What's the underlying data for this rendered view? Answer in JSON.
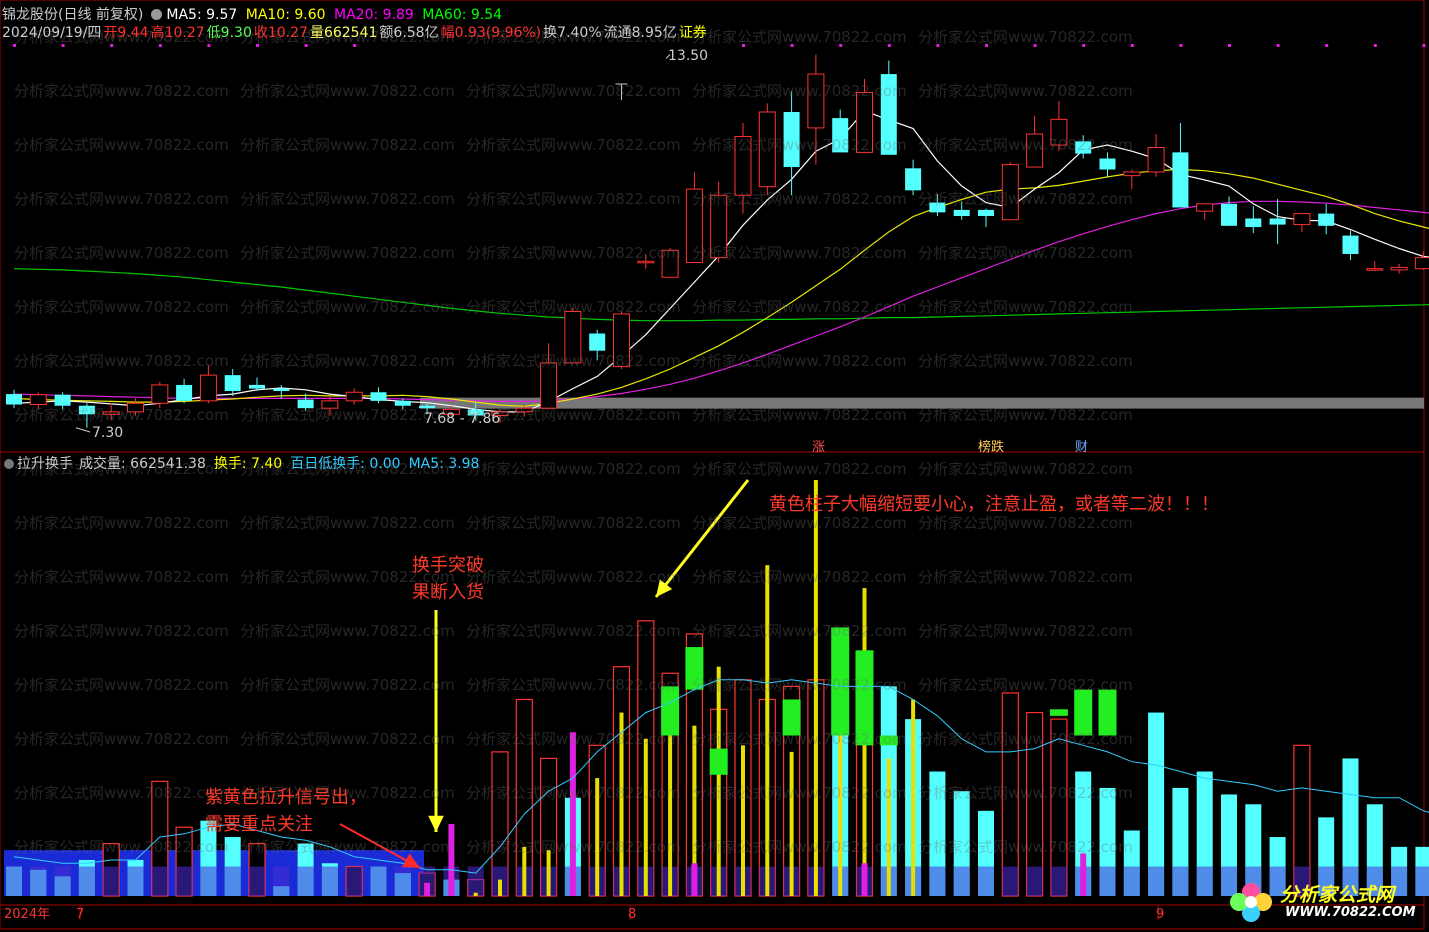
{
  "header": {
    "title": "锦龙股份(日线 前复权)",
    "ma5_label": "MA5: 9.57",
    "ma10_label": "MA10: 9.60",
    "ma20_label": "MA20: 9.89",
    "ma60_label": "MA60: 9.54",
    "date": "2024/09/19/四",
    "open": "开9.44",
    "high": "高10.27",
    "low": "低9.30",
    "close": "收10.27",
    "volume": "量662541",
    "amount": "额6.58亿",
    "change": "幅0.93(9.96%)",
    "turnover": "换7.40%",
    "float_cap": "流通8.95亿",
    "sector": "证券",
    "colors": {
      "ma5": "#ffffff",
      "ma10": "#ffff00",
      "ma20": "#ff00ff",
      "ma60": "#00ff00",
      "up": "#ff3232",
      "down": "#54ffff"
    }
  },
  "price_labels": {
    "high_label": "13.50",
    "low_label": "7.30",
    "band_label": "7.68 - 7.86"
  },
  "event_tags": {
    "t1": "涨",
    "t2": "榜跌",
    "t3": "财"
  },
  "indicator": {
    "name": "拉升换手",
    "vol_label": "成交量: 662541.38",
    "turn_label": "换手: 7.40",
    "low_turn_label": "百日低换手: 0.00",
    "ma5_label": "MA5: 3.98"
  },
  "annotations": {
    "a1_l1": "换手突破",
    "a1_l2": "果断入货",
    "a2": "黄色柱子大幅缩短要小心，注意止盈，或者等二波！！！",
    "a3_l1": "紫黄色拉升信号出，",
    "a3_l2": "需要重点关注"
  },
  "time_axis": {
    "year": "2024年",
    "m7": "7",
    "m8": "8",
    "m9": "9"
  },
  "watermark": "分析家公式网www.70822.com",
  "logo": {
    "name": "分析家公式网",
    "url": "WWW.70822.COM"
  },
  "chart_data": {
    "type": "candlestick",
    "candles": [
      {
        "o": 7.95,
        "h": 8.02,
        "l": 7.72,
        "c": 7.78
      },
      {
        "o": 7.78,
        "h": 7.98,
        "l": 7.7,
        "c": 7.94
      },
      {
        "o": 7.94,
        "h": 7.98,
        "l": 7.7,
        "c": 7.76
      },
      {
        "o": 7.76,
        "h": 7.8,
        "l": 7.4,
        "c": 7.62
      },
      {
        "o": 7.62,
        "h": 7.8,
        "l": 7.52,
        "c": 7.66
      },
      {
        "o": 7.66,
        "h": 7.88,
        "l": 7.6,
        "c": 7.8
      },
      {
        "o": 7.8,
        "h": 8.15,
        "l": 7.72,
        "c": 8.1
      },
      {
        "o": 8.1,
        "h": 8.2,
        "l": 7.8,
        "c": 7.84
      },
      {
        "o": 7.84,
        "h": 8.42,
        "l": 7.8,
        "c": 8.26
      },
      {
        "o": 8.26,
        "h": 8.36,
        "l": 7.92,
        "c": 8.0
      },
      {
        "o": 8.1,
        "h": 8.22,
        "l": 8.0,
        "c": 8.04
      },
      {
        "o": 8.04,
        "h": 8.1,
        "l": 7.88,
        "c": 8.0
      },
      {
        "o": 7.86,
        "h": 7.96,
        "l": 7.68,
        "c": 7.72
      },
      {
        "o": 7.72,
        "h": 7.92,
        "l": 7.6,
        "c": 7.84
      },
      {
        "o": 7.84,
        "h": 8.04,
        "l": 7.78,
        "c": 7.98
      },
      {
        "o": 7.98,
        "h": 8.06,
        "l": 7.8,
        "c": 7.84
      },
      {
        "o": 7.84,
        "h": 7.88,
        "l": 7.7,
        "c": 7.76
      },
      {
        "o": 7.76,
        "h": 7.82,
        "l": 7.62,
        "c": 7.72
      },
      {
        "o": 7.62,
        "h": 7.76,
        "l": 7.56,
        "c": 7.7
      },
      {
        "o": 7.7,
        "h": 7.82,
        "l": 7.52,
        "c": 7.6
      },
      {
        "o": 7.6,
        "h": 7.7,
        "l": 7.48,
        "c": 7.66
      },
      {
        "o": 7.66,
        "h": 7.76,
        "l": 7.58,
        "c": 7.72
      },
      {
        "o": 7.72,
        "h": 8.78,
        "l": 7.72,
        "c": 8.46
      },
      {
        "o": 8.46,
        "h": 9.36,
        "l": 8.46,
        "c": 9.3
      },
      {
        "o": 8.94,
        "h": 9.0,
        "l": 8.5,
        "c": 8.66
      },
      {
        "o": 8.4,
        "h": 9.3,
        "l": 8.36,
        "c": 9.26
      },
      {
        "o": 10.12,
        "h": 10.24,
        "l": 10.0,
        "c": 10.12
      },
      {
        "o": 9.86,
        "h": 10.34,
        "l": 9.86,
        "c": 10.3
      },
      {
        "o": 10.1,
        "h": 11.58,
        "l": 10.1,
        "c": 11.3
      },
      {
        "o": 10.18,
        "h": 11.42,
        "l": 10.1,
        "c": 11.2
      },
      {
        "o": 11.2,
        "h": 12.38,
        "l": 10.9,
        "c": 12.16
      },
      {
        "o": 11.34,
        "h": 12.7,
        "l": 11.2,
        "c": 12.56
      },
      {
        "o": 12.56,
        "h": 12.9,
        "l": 11.2,
        "c": 11.66
      },
      {
        "o": 12.3,
        "h": 13.5,
        "l": 11.7,
        "c": 13.18
      },
      {
        "o": 12.46,
        "h": 12.6,
        "l": 11.9,
        "c": 11.9
      },
      {
        "o": 11.9,
        "h": 13.1,
        "l": 11.9,
        "c": 12.88
      },
      {
        "o": 13.18,
        "h": 13.4,
        "l": 11.86,
        "c": 11.86
      },
      {
        "o": 11.64,
        "h": 11.78,
        "l": 11.2,
        "c": 11.28
      },
      {
        "o": 11.08,
        "h": 11.22,
        "l": 10.86,
        "c": 10.92
      },
      {
        "o": 10.96,
        "h": 11.1,
        "l": 10.8,
        "c": 10.86
      },
      {
        "o": 10.96,
        "h": 10.98,
        "l": 10.68,
        "c": 10.86
      },
      {
        "o": 10.8,
        "h": 11.74,
        "l": 10.8,
        "c": 11.7
      },
      {
        "o": 11.66,
        "h": 12.5,
        "l": 11.66,
        "c": 12.2
      },
      {
        "o": 12.02,
        "h": 12.74,
        "l": 11.92,
        "c": 12.44
      },
      {
        "o": 12.08,
        "h": 12.18,
        "l": 11.8,
        "c": 11.88
      },
      {
        "o": 11.8,
        "h": 11.9,
        "l": 11.5,
        "c": 11.62
      },
      {
        "o": 11.52,
        "h": 11.62,
        "l": 11.3,
        "c": 11.58
      },
      {
        "o": 11.58,
        "h": 12.2,
        "l": 11.5,
        "c": 11.98
      },
      {
        "o": 11.9,
        "h": 12.38,
        "l": 11.0,
        "c": 11.0
      },
      {
        "o": 10.94,
        "h": 11.06,
        "l": 10.8,
        "c": 11.06
      },
      {
        "o": 11.06,
        "h": 11.18,
        "l": 10.7,
        "c": 10.7
      },
      {
        "o": 10.82,
        "h": 11.02,
        "l": 10.58,
        "c": 10.68
      },
      {
        "o": 10.82,
        "h": 11.14,
        "l": 10.4,
        "c": 10.72
      },
      {
        "o": 10.72,
        "h": 10.9,
        "l": 10.6,
        "c": 10.9
      },
      {
        "o": 10.9,
        "h": 11.06,
        "l": 10.56,
        "c": 10.7
      },
      {
        "o": 10.54,
        "h": 10.62,
        "l": 10.14,
        "c": 10.24
      },
      {
        "o": 10.0,
        "h": 10.12,
        "l": 9.96,
        "c": 10.0
      },
      {
        "o": 9.98,
        "h": 10.08,
        "l": 9.92,
        "c": 10.02
      },
      {
        "o": 10.0,
        "h": 10.28,
        "l": 9.98,
        "c": 10.18
      },
      {
        "o": 10.62,
        "h": 11.0,
        "l": 10.6,
        "c": 10.62
      },
      {
        "o": 10.14,
        "h": 10.42,
        "l": 10.0,
        "c": 10.36
      },
      {
        "o": 10.34,
        "h": 10.4,
        "l": 10.22,
        "c": 10.3
      },
      {
        "o": 10.2,
        "h": 10.24,
        "l": 10.06,
        "c": 10.16
      },
      {
        "o": 10.16,
        "h": 10.26,
        "l": 10.08,
        "c": 10.2
      },
      {
        "o": 10.16,
        "h": 10.22,
        "l": 10.02,
        "c": 10.04
      },
      {
        "o": 10.04,
        "h": 10.18,
        "l": 9.96,
        "c": 10.14
      },
      {
        "o": 9.94,
        "h": 10.14,
        "l": 9.88,
        "c": 10.04
      },
      {
        "o": 9.44,
        "h": 10.27,
        "l": 9.3,
        "c": 10.27
      }
    ],
    "ma5": [
      7.8,
      7.82,
      7.84,
      7.82,
      7.79,
      7.76,
      7.8,
      7.86,
      7.92,
      7.95,
      8.02,
      8.05,
      8.02,
      7.95,
      7.91,
      7.86,
      7.83,
      7.81,
      7.76,
      7.7,
      7.66,
      7.66,
      7.83,
      8.04,
      8.24,
      8.57,
      8.92,
      9.35,
      9.78,
      10.21,
      10.71,
      11.12,
      11.46,
      11.92,
      12.12,
      12.58,
      12.43,
      12.29,
      11.76,
      11.35,
      11.08,
      11.0,
      11.3,
      11.57,
      11.94,
      12.02,
      11.92,
      11.8,
      11.54,
      11.45,
      11.35,
      11.06,
      10.85,
      10.79,
      10.78,
      10.64,
      10.48,
      10.33,
      10.2,
      10.15,
      10.18,
      10.28,
      10.34,
      10.32,
      10.24,
      10.18,
      10.15,
      10.06,
      10.09
    ],
    "ma10": [
      7.88,
      7.86,
      7.85,
      7.84,
      7.83,
      7.82,
      7.82,
      7.83,
      7.85,
      7.87,
      7.9,
      7.92,
      7.93,
      7.92,
      7.92,
      7.92,
      7.93,
      7.91,
      7.87,
      7.82,
      7.77,
      7.75,
      7.8,
      7.87,
      7.95,
      8.06,
      8.2,
      8.36,
      8.55,
      8.74,
      8.96,
      9.2,
      9.45,
      9.72,
      9.99,
      10.3,
      10.6,
      10.85,
      11.0,
      11.13,
      11.25,
      11.3,
      11.32,
      11.36,
      11.43,
      11.5,
      11.56,
      11.6,
      11.62,
      11.6,
      11.55,
      11.48,
      11.38,
      11.28,
      11.18,
      11.05,
      10.9,
      10.78,
      10.68,
      10.58,
      10.5,
      10.44,
      10.39,
      10.33,
      10.28,
      10.24,
      10.19,
      10.15,
      10.12
    ],
    "ma20": [
      7.95,
      7.94,
      7.93,
      7.92,
      7.91,
      7.9,
      7.89,
      7.88,
      7.88,
      7.88,
      7.88,
      7.88,
      7.88,
      7.88,
      7.88,
      7.88,
      7.87,
      7.86,
      7.85,
      7.84,
      7.83,
      7.83,
      7.84,
      7.87,
      7.91,
      7.96,
      8.03,
      8.11,
      8.21,
      8.33,
      8.46,
      8.6,
      8.75,
      8.9,
      9.05,
      9.21,
      9.38,
      9.55,
      9.7,
      9.85,
      10.0,
      10.15,
      10.3,
      10.44,
      10.57,
      10.69,
      10.8,
      10.9,
      10.98,
      11.04,
      11.08,
      11.1,
      11.1,
      11.09,
      11.07,
      11.04,
      11.0,
      10.96,
      10.92,
      10.88,
      10.84,
      10.8,
      10.76,
      10.72,
      10.68,
      10.63,
      10.58,
      10.52,
      10.45
    ],
    "ma60": [
      10.0,
      9.99,
      9.98,
      9.96,
      9.94,
      9.92,
      9.89,
      9.86,
      9.82,
      9.78,
      9.74,
      9.7,
      9.65,
      9.6,
      9.55,
      9.5,
      9.45,
      9.4,
      9.35,
      9.31,
      9.27,
      9.24,
      9.21,
      9.19,
      9.17,
      9.16,
      9.15,
      9.15,
      9.15,
      9.16,
      9.16,
      9.17,
      9.17,
      9.18,
      9.18,
      9.19,
      9.2,
      9.2,
      9.21,
      9.22,
      9.23,
      9.24,
      9.25,
      9.26,
      9.27,
      9.28,
      9.29,
      9.3,
      9.31,
      9.32,
      9.33,
      9.34,
      9.35,
      9.36,
      9.37,
      9.38,
      9.39,
      9.4,
      9.41,
      9.42,
      9.43,
      9.44,
      9.45,
      9.46,
      9.47,
      9.48,
      9.5,
      9.52,
      9.54
    ],
    "volume": [
      {
        "v": 0.9,
        "up": false
      },
      {
        "v": 0.8,
        "up": false
      },
      {
        "v": 0.6,
        "up": false
      },
      {
        "v": 1.1,
        "up": false
      },
      {
        "v": 1.6,
        "up": true
      },
      {
        "v": 1.1,
        "up": false
      },
      {
        "v": 3.5,
        "up": true
      },
      {
        "v": 2.1,
        "up": true
      },
      {
        "v": 2.3,
        "up": false
      },
      {
        "v": 1.8,
        "up": false
      },
      {
        "v": 1.6,
        "up": true
      },
      {
        "v": 0.3,
        "up": false
      },
      {
        "v": 1.6,
        "up": false
      },
      {
        "v": 1.0,
        "up": false
      },
      {
        "v": 0.9,
        "up": true
      },
      {
        "v": 0.9,
        "up": false
      },
      {
        "v": 0.7,
        "up": false
      },
      {
        "v": 0.7,
        "up": true
      },
      {
        "v": 0.5,
        "up": false
      },
      {
        "v": 0.5,
        "up": true
      },
      {
        "v": 4.4,
        "up": true
      },
      {
        "v": 6.0,
        "up": true
      },
      {
        "v": 4.2,
        "up": true
      },
      {
        "v": 3.0,
        "up": false
      },
      {
        "v": 4.6,
        "up": true
      },
      {
        "v": 7.0,
        "up": true
      },
      {
        "v": 8.4,
        "up": true
      },
      {
        "v": 6.8,
        "up": true
      },
      {
        "v": 8.0,
        "up": true
      },
      {
        "v": 5.7,
        "up": true
      },
      {
        "v": 6.6,
        "up": true
      },
      {
        "v": 6.0,
        "up": true
      },
      {
        "v": 6.4,
        "up": true
      },
      {
        "v": 6.6,
        "up": true
      },
      {
        "v": 6.5,
        "up": false
      },
      {
        "v": 5.6,
        "up": true
      },
      {
        "v": 6.4,
        "up": false
      },
      {
        "v": 5.4,
        "up": false
      },
      {
        "v": 3.8,
        "up": false
      },
      {
        "v": 3.2,
        "up": false
      },
      {
        "v": 2.6,
        "up": false
      },
      {
        "v": 6.2,
        "up": true
      },
      {
        "v": 5.6,
        "up": true
      },
      {
        "v": 5.4,
        "up": true
      },
      {
        "v": 3.8,
        "up": false
      },
      {
        "v": 3.3,
        "up": false
      },
      {
        "v": 2.0,
        "up": false
      },
      {
        "v": 5.6,
        "up": false
      },
      {
        "v": 3.3,
        "up": false
      },
      {
        "v": 3.8,
        "up": false
      },
      {
        "v": 3.1,
        "up": false
      },
      {
        "v": 2.8,
        "up": false
      },
      {
        "v": 1.8,
        "up": false
      },
      {
        "v": 4.6,
        "up": true
      },
      {
        "v": 2.4,
        "up": false
      },
      {
        "v": 4.2,
        "up": false
      },
      {
        "v": 2.8,
        "up": false
      },
      {
        "v": 1.5,
        "up": false
      },
      {
        "v": 1.5,
        "up": false
      },
      {
        "v": 1.7,
        "up": false
      },
      {
        "v": 6.4,
        "up": false
      },
      {
        "v": 4.0,
        "up": true
      },
      {
        "v": 2.5,
        "up": false
      },
      {
        "v": 1.3,
        "up": false
      },
      {
        "v": 1.5,
        "up": false
      },
      {
        "v": 0.9,
        "up": false
      },
      {
        "v": 1.9,
        "up": false
      },
      {
        "v": 0.9,
        "up": false
      },
      {
        "v": 3.7,
        "up": true
      }
    ],
    "yellow_signal": {
      "19": 0.1,
      "20": 0.5,
      "21": 1.5,
      "22": 1.4,
      "23": 1.3,
      "24": 3.6,
      "25": 5.6,
      "26": 4.8,
      "27": 5.6,
      "28": 5.2,
      "29": 7.0,
      "30": 4.6,
      "31": 10.1,
      "32": 4.4,
      "33": 12.7,
      "34": 5.4,
      "35": 9.4,
      "36": 4.2,
      "37": 6.0
    },
    "green_signal": {
      "27": [
        4.9,
        6.4
      ],
      "28": [
        6.3,
        7.6
      ],
      "29": [
        3.7,
        4.5
      ],
      "32": [
        4.9,
        6.0
      ],
      "34": [
        4.9,
        8.2
      ],
      "35": [
        4.6,
        7.5
      ],
      "36": [
        4.6,
        4.9
      ],
      "43": [
        5.5,
        5.7
      ],
      "44": [
        4.9,
        6.3
      ],
      "45": [
        4.9,
        6.3
      ],
      "66": [
        5.5,
        6.2
      ]
    },
    "purple_signal": {
      "17": 0.4,
      "18": 2.2,
      "23": 5.0,
      "28": 1.0,
      "35": 1.0,
      "44": 1.3
    },
    "vol_ma": [
      1.2,
      1.1,
      1.0,
      1.0,
      1.1,
      1.1,
      1.8,
      1.9,
      2.1,
      2.2,
      2.0,
      1.8,
      1.7,
      1.5,
      1.2,
      1.1,
      1.0,
      0.8,
      0.8,
      0.7,
      1.5,
      2.5,
      3.2,
      3.6,
      4.4,
      5.0,
      5.6,
      5.9,
      6.3,
      6.6,
      6.6,
      6.5,
      6.6,
      6.5,
      6.4,
      6.4,
      6.4,
      6.0,
      5.5,
      4.8,
      4.4,
      4.4,
      4.5,
      4.8,
      4.6,
      4.4,
      4.1,
      4.0,
      3.8,
      3.6,
      3.5,
      3.4,
      3.2,
      3.3,
      3.2,
      3.1,
      3.0,
      3.0,
      2.6,
      2.4,
      2.7,
      2.9,
      3.0,
      2.6,
      2.4,
      2.2,
      2.0,
      1.8,
      2.2
    ],
    "ylim_price": [
      7.2,
      13.9
    ],
    "ylim_volume": [
      0,
      12.7
    ]
  }
}
